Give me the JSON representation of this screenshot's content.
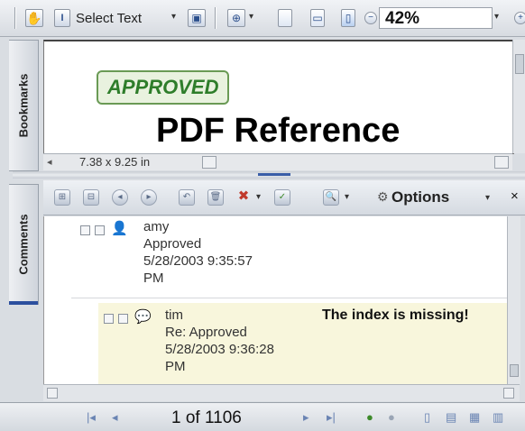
{
  "toolbar": {
    "select_text_label": "Select Text",
    "zoom_value": "42%",
    "icons": [
      "hand-icon",
      "select-text-icon",
      "snapshot-icon",
      "zoom-in-icon",
      "page-icon",
      "page-width-icon",
      "fit-page-icon",
      "zoom-out-icon"
    ]
  },
  "bookmarks_tab": {
    "label": "Bookmarks"
  },
  "comments_tab": {
    "label": "Comments"
  },
  "document": {
    "stamp_text": "APPROVED",
    "title": "PDF  Reference",
    "page_size": "7.38 x 9.25 in"
  },
  "comments_toolbar": {
    "options_label": "Options"
  },
  "comments": [
    {
      "author": "amy",
      "text": "Approved",
      "date": "5/28/2003 9:35:57",
      "time_suffix": "PM"
    },
    {
      "author": "tim",
      "text": "Re: Approved",
      "date": "5/28/2003 9:36:28",
      "time_suffix": "PM",
      "note": "The index is missing!"
    }
  ],
  "navigation": {
    "page_info": "1 of 1106"
  },
  "colors": {
    "stamp_green": "#2e7d2a",
    "reply_background": "#f8f6dc",
    "toolbar_bg": "#d7dbe1"
  }
}
